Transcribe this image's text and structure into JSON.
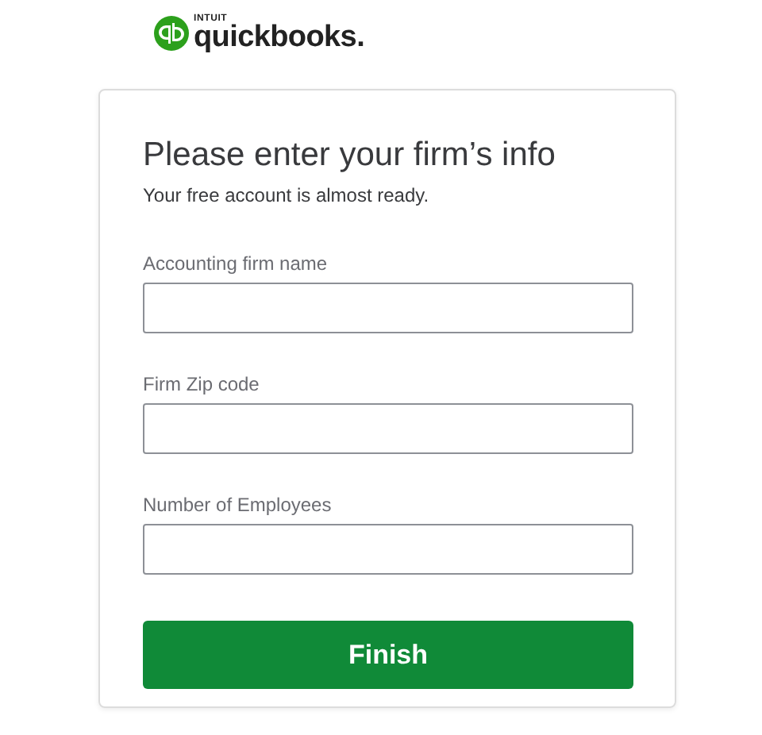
{
  "logo": {
    "brand": "INTUIT",
    "product": "quickbooks."
  },
  "form": {
    "title": "Please enter your firm’s info",
    "subtitle": "Your free account is almost ready.",
    "fields": [
      {
        "label": "Accounting firm name"
      },
      {
        "label": "Firm Zip code"
      },
      {
        "label": "Number of Employees"
      }
    ],
    "submit": "Finish"
  }
}
